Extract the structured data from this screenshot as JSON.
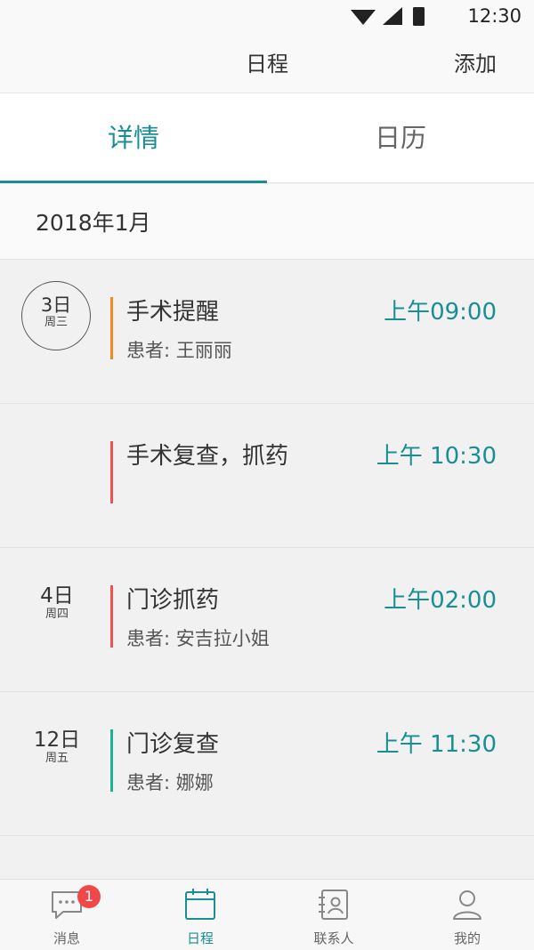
{
  "status_bar": {
    "time": "12:30"
  },
  "nav": {
    "title": "日程",
    "add_label": "添加"
  },
  "tabs": [
    {
      "label": "详情",
      "active": true
    },
    {
      "label": "日历",
      "active": false
    }
  ],
  "month": "2018年1月",
  "events": [
    {
      "date_day": "3日",
      "date_week": "周三",
      "circled": true,
      "title": "手术提醒",
      "time": "上午09:00",
      "patient": "患者: 王丽丽",
      "bar_color": "#f08a24"
    },
    {
      "date_day": "",
      "date_week": "",
      "circled": false,
      "title": "手术复查，抓药",
      "time": "上午 10:30",
      "patient": "",
      "bar_color": "#ef5350"
    },
    {
      "date_day": "4日",
      "date_week": "周四",
      "circled": false,
      "title": "门诊抓药",
      "time": "上午02:00",
      "patient": "患者: 安吉拉小姐",
      "bar_color": "#ef5350"
    },
    {
      "date_day": "12日",
      "date_week": "周五",
      "circled": false,
      "title": "门诊复查",
      "time": "上午  11:30",
      "patient": "患者: 娜娜",
      "bar_color": "#1ab394"
    }
  ],
  "bottom_nav": [
    {
      "label": "消息",
      "icon": "chat-icon",
      "badge": "1",
      "active": false
    },
    {
      "label": "日程",
      "icon": "calendar-icon",
      "badge": "",
      "active": true
    },
    {
      "label": "联系人",
      "icon": "contacts-icon",
      "badge": "",
      "active": false
    },
    {
      "label": "我的",
      "icon": "person-icon",
      "badge": "",
      "active": false
    }
  ],
  "colors": {
    "accent": "#1a8f93",
    "badge": "#f04848"
  }
}
